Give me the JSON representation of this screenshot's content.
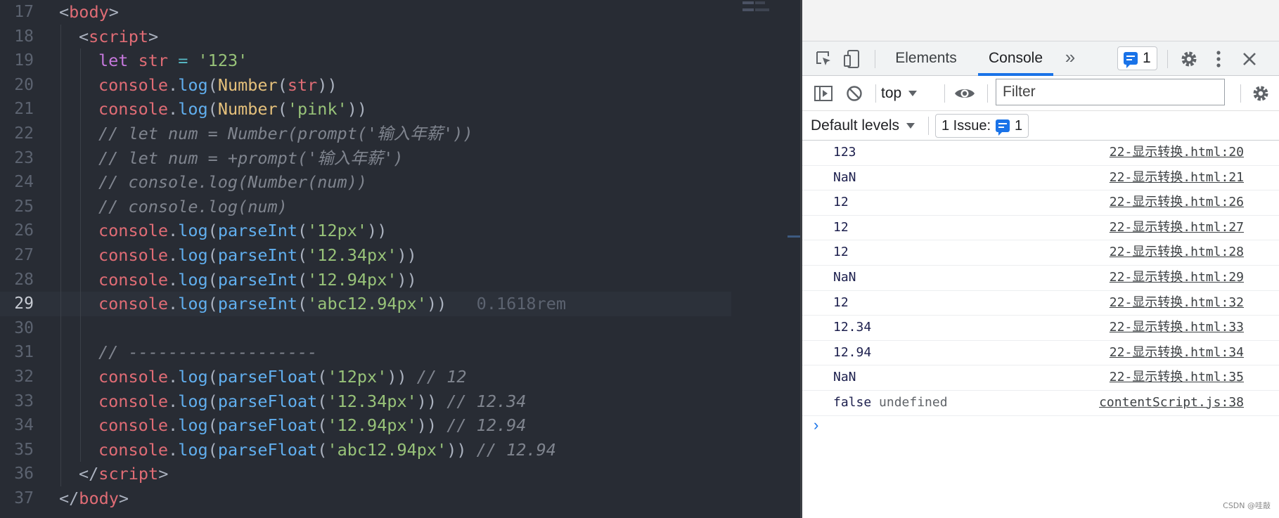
{
  "editor": {
    "active_line": "29",
    "lines": [
      {
        "n": "17",
        "indent": 0,
        "tokens": [
          [
            "punc",
            "<"
          ],
          [
            "tag",
            "body"
          ],
          [
            "punc",
            ">"
          ]
        ]
      },
      {
        "n": "18",
        "indent": 1,
        "tokens": [
          [
            "punc",
            "<"
          ],
          [
            "tag",
            "script"
          ],
          [
            "punc",
            ">"
          ]
        ]
      },
      {
        "n": "19",
        "indent": 2,
        "tokens": [
          [
            "kw",
            "let"
          ],
          [
            "punc",
            " "
          ],
          [
            "id",
            "str"
          ],
          [
            "punc",
            " "
          ],
          [
            "op",
            "="
          ],
          [
            "punc",
            " "
          ],
          [
            "str",
            "'123'"
          ]
        ]
      },
      {
        "n": "20",
        "indent": 2,
        "tokens": [
          [
            "id",
            "console"
          ],
          [
            "punc",
            "."
          ],
          [
            "fn",
            "log"
          ],
          [
            "punc",
            "("
          ],
          [
            "cls",
            "Number"
          ],
          [
            "punc",
            "("
          ],
          [
            "id",
            "str"
          ],
          [
            "punc",
            "))"
          ]
        ]
      },
      {
        "n": "21",
        "indent": 2,
        "tokens": [
          [
            "id",
            "console"
          ],
          [
            "punc",
            "."
          ],
          [
            "fn",
            "log"
          ],
          [
            "punc",
            "("
          ],
          [
            "cls",
            "Number"
          ],
          [
            "punc",
            "("
          ],
          [
            "str",
            "'pink'"
          ],
          [
            "punc",
            "))"
          ]
        ]
      },
      {
        "n": "22",
        "indent": 2,
        "tokens": [
          [
            "cm",
            "// let num = Number(prompt('输入年薪'))"
          ]
        ]
      },
      {
        "n": "23",
        "indent": 2,
        "tokens": [
          [
            "cm",
            "// let num = +prompt('输入年薪')"
          ]
        ]
      },
      {
        "n": "24",
        "indent": 2,
        "tokens": [
          [
            "cm",
            "// console.log(Number(num))"
          ]
        ]
      },
      {
        "n": "25",
        "indent": 2,
        "tokens": [
          [
            "cm",
            "// console.log(num)"
          ]
        ]
      },
      {
        "n": "26",
        "indent": 2,
        "tokens": [
          [
            "id",
            "console"
          ],
          [
            "punc",
            "."
          ],
          [
            "fn",
            "log"
          ],
          [
            "punc",
            "("
          ],
          [
            "fn",
            "parseInt"
          ],
          [
            "punc",
            "("
          ],
          [
            "str",
            "'12px'"
          ],
          [
            "punc",
            "))"
          ]
        ]
      },
      {
        "n": "27",
        "indent": 2,
        "tokens": [
          [
            "id",
            "console"
          ],
          [
            "punc",
            "."
          ],
          [
            "fn",
            "log"
          ],
          [
            "punc",
            "("
          ],
          [
            "fn",
            "parseInt"
          ],
          [
            "punc",
            "("
          ],
          [
            "str",
            "'12.34px'"
          ],
          [
            "punc",
            "))"
          ]
        ]
      },
      {
        "n": "28",
        "indent": 2,
        "tokens": [
          [
            "id",
            "console"
          ],
          [
            "punc",
            "."
          ],
          [
            "fn",
            "log"
          ],
          [
            "punc",
            "("
          ],
          [
            "fn",
            "parseInt"
          ],
          [
            "punc",
            "("
          ],
          [
            "str",
            "'12.94px'"
          ],
          [
            "punc",
            "))"
          ]
        ]
      },
      {
        "n": "29",
        "indent": 2,
        "tokens": [
          [
            "id",
            "console"
          ],
          [
            "punc",
            "."
          ],
          [
            "fn",
            "log"
          ],
          [
            "punc",
            "("
          ],
          [
            "fn",
            "parseInt"
          ],
          [
            "punc",
            "("
          ],
          [
            "str",
            "'abc12.94px'"
          ],
          [
            "punc",
            "))"
          ],
          [
            "hint",
            "   0.1618rem"
          ]
        ]
      },
      {
        "n": "30",
        "indent": 2,
        "tokens": []
      },
      {
        "n": "31",
        "indent": 2,
        "tokens": [
          [
            "cm",
            "// -------------------"
          ]
        ]
      },
      {
        "n": "32",
        "indent": 2,
        "tokens": [
          [
            "id",
            "console"
          ],
          [
            "punc",
            "."
          ],
          [
            "fn",
            "log"
          ],
          [
            "punc",
            "("
          ],
          [
            "fn",
            "parseFloat"
          ],
          [
            "punc",
            "("
          ],
          [
            "str",
            "'12px'"
          ],
          [
            "punc",
            "))"
          ],
          [
            "cm",
            " // 12"
          ]
        ]
      },
      {
        "n": "33",
        "indent": 2,
        "tokens": [
          [
            "id",
            "console"
          ],
          [
            "punc",
            "."
          ],
          [
            "fn",
            "log"
          ],
          [
            "punc",
            "("
          ],
          [
            "fn",
            "parseFloat"
          ],
          [
            "punc",
            "("
          ],
          [
            "str",
            "'12.34px'"
          ],
          [
            "punc",
            "))"
          ],
          [
            "cm",
            " // 12.34"
          ]
        ]
      },
      {
        "n": "34",
        "indent": 2,
        "tokens": [
          [
            "id",
            "console"
          ],
          [
            "punc",
            "."
          ],
          [
            "fn",
            "log"
          ],
          [
            "punc",
            "("
          ],
          [
            "fn",
            "parseFloat"
          ],
          [
            "punc",
            "("
          ],
          [
            "str",
            "'12.94px'"
          ],
          [
            "punc",
            "))"
          ],
          [
            "cm",
            " // 12.94"
          ]
        ]
      },
      {
        "n": "35",
        "indent": 2,
        "tokens": [
          [
            "id",
            "console"
          ],
          [
            "punc",
            "."
          ],
          [
            "fn",
            "log"
          ],
          [
            "punc",
            "("
          ],
          [
            "fn",
            "parseFloat"
          ],
          [
            "punc",
            "("
          ],
          [
            "str",
            "'abc12.94px'"
          ],
          [
            "punc",
            "))"
          ],
          [
            "cm",
            " // 12.94"
          ]
        ]
      },
      {
        "n": "36",
        "indent": 1,
        "tokens": [
          [
            "punc",
            "</"
          ],
          [
            "tag",
            "script"
          ],
          [
            "punc",
            ">"
          ]
        ]
      },
      {
        "n": "37",
        "indent": 0,
        "tokens": [
          [
            "punc",
            "</"
          ],
          [
            "tag",
            "body"
          ],
          [
            "punc",
            ">"
          ]
        ]
      }
    ]
  },
  "devtools": {
    "tabs": {
      "elements": "Elements",
      "console": "Console",
      "more": "»"
    },
    "issues_count": "1",
    "context": "top",
    "filter_placeholder": "Filter",
    "levels": "Default levels",
    "issues_label": "1 Issue:",
    "issues_badge": "1",
    "console_rows": [
      {
        "msg": "123",
        "src": "22-显示转换.html:20"
      },
      {
        "msg": "NaN",
        "src": "22-显示转换.html:21"
      },
      {
        "msg": "12",
        "src": "22-显示转换.html:26"
      },
      {
        "msg": "12",
        "src": "22-显示转换.html:27"
      },
      {
        "msg": "12",
        "src": "22-显示转换.html:28"
      },
      {
        "msg": "NaN",
        "src": "22-显示转换.html:29"
      },
      {
        "msg": "12",
        "src": "22-显示转换.html:32"
      },
      {
        "msg": "12.34",
        "src": "22-显示转换.html:33"
      },
      {
        "msg": "12.94",
        "src": "22-显示转换.html:34"
      },
      {
        "msg": "NaN",
        "src": "22-显示转换.html:35"
      },
      {
        "msg": "false",
        "extra": "undefined",
        "src": "contentScript.js:38"
      }
    ],
    "prompt": "›"
  },
  "watermark": "CSDN @哇敲",
  "colors": {
    "accent": "#1a73e8",
    "editor_bg": "#282c34"
  },
  "icons": [
    "inspect-icon",
    "device-toggle-icon",
    "issues-message-icon",
    "gear-icon",
    "kebab-menu-icon",
    "close-icon",
    "sidebar-toggle-icon",
    "clear-console-icon",
    "dropdown-caret-icon",
    "eye-icon"
  ]
}
